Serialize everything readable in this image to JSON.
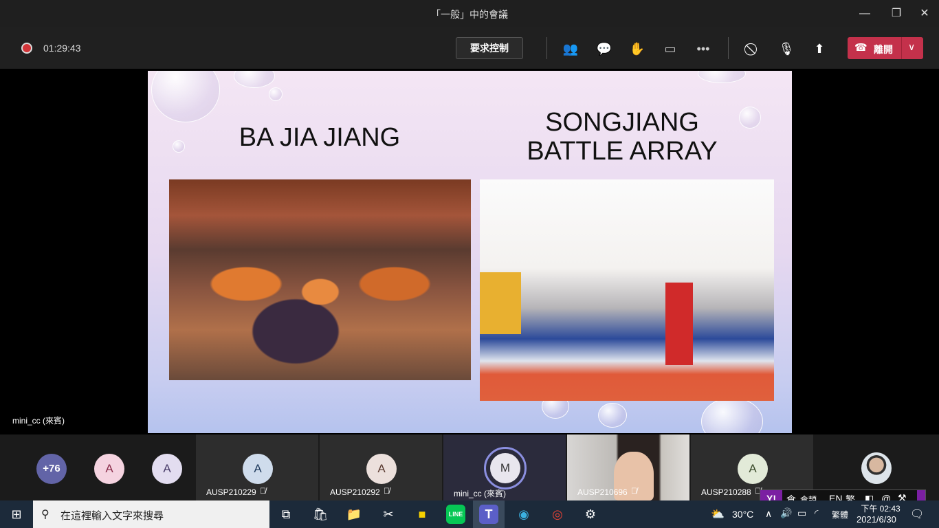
{
  "window": {
    "title": "「一般」中的會議",
    "controls": [
      "minimize",
      "maximize",
      "close"
    ]
  },
  "toolbar": {
    "elapsed": "01:29:43",
    "request_control": "要求控制",
    "leave_label": "離開",
    "icons": [
      "participants-icon",
      "chat-icon",
      "reactions-icon",
      "rooms-icon",
      "more-icon",
      "camera-off-icon",
      "mic-off-icon",
      "share-icon"
    ]
  },
  "slide": {
    "title_left": "BA JIA JIANG",
    "title_right_1": "SONGJIANG",
    "title_right_2": "BATTLE ARRAY"
  },
  "stage": {
    "presenter_label": "mini_cc (來賓)"
  },
  "filmstrip": {
    "overflow": "+76",
    "avatars": [
      {
        "initial": "A",
        "color": "#f5d3e0",
        "fg": "#8a2c4a"
      },
      {
        "initial": "A",
        "color": "#e3ddf0",
        "fg": "#4a3d6a"
      }
    ],
    "tiles": [
      {
        "name": "AUSP210229",
        "initial": "A",
        "color": "#cfdcec",
        "fg": "#1f3a5c",
        "muted": true
      },
      {
        "name": "AUSP210292",
        "initial": "A",
        "color": "#ece0dc",
        "fg": "#5a3a30",
        "muted": true
      },
      {
        "name": "mini_cc (來賓)",
        "initial": "M",
        "color": "#e8e6ee",
        "fg": "#333",
        "muted": false
      },
      {
        "name": "AUSP210696",
        "muted": true
      },
      {
        "name": "AUSP210288",
        "initial": "A",
        "color": "#e2ead8",
        "fg": "#3a4a2a",
        "muted": true
      }
    ]
  },
  "ime": {
    "logo": "Y!",
    "mode": "倉",
    "name": "倉頡",
    "lang": "EN",
    "script": "繁"
  },
  "taskbar": {
    "search_placeholder": "在這裡輸入文字來搜尋",
    "weather": "30°C",
    "input": "繁體",
    "time": "下午 02:43",
    "date": "2021/6/30"
  },
  "colors": {
    "leave": "#c4314b",
    "record": "#d13438",
    "accent": "#6264a7"
  }
}
